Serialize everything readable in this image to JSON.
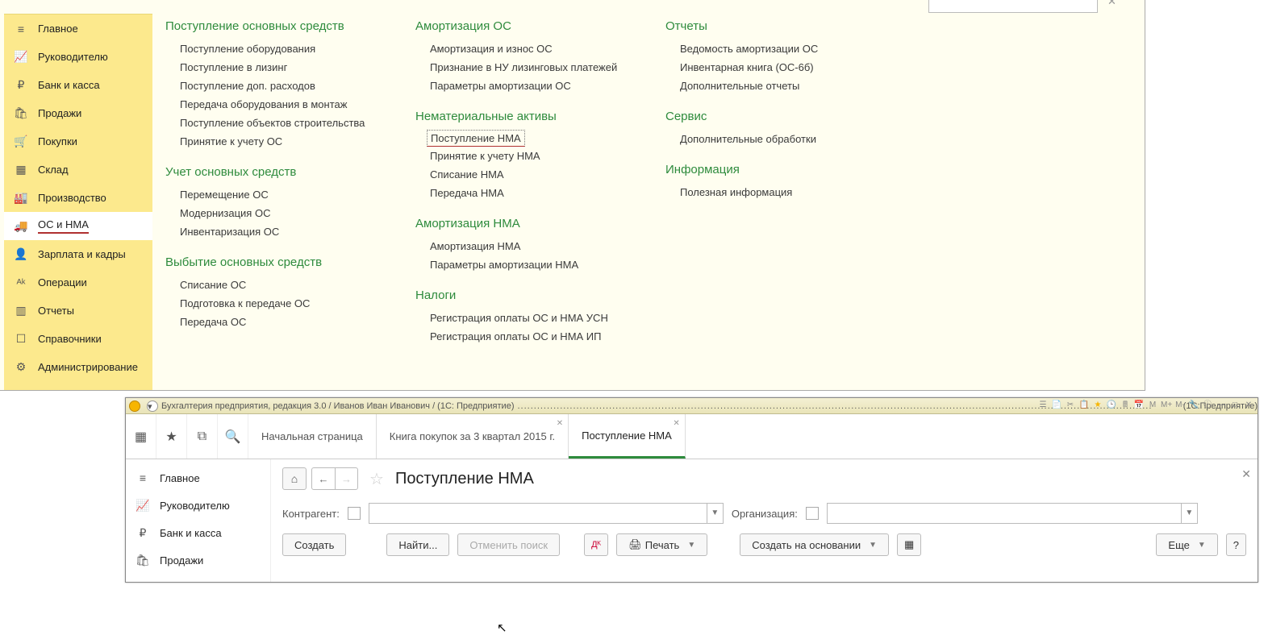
{
  "sidebar": {
    "items": [
      {
        "label": "Главное",
        "icon": "≡"
      },
      {
        "label": "Руководителю",
        "icon": "📈"
      },
      {
        "label": "Банк и касса",
        "icon": "₽"
      },
      {
        "label": "Продажи",
        "icon": "🛍"
      },
      {
        "label": "Покупки",
        "icon": "🛒"
      },
      {
        "label": "Склад",
        "icon": "▦"
      },
      {
        "label": "Производство",
        "icon": "🏭"
      },
      {
        "label": "ОС и НМА",
        "icon": "🚚"
      },
      {
        "label": "Зарплата и кадры",
        "icon": "👤"
      },
      {
        "label": "Операции",
        "icon": "ᴬᵏ"
      },
      {
        "label": "Отчеты",
        "icon": "▥"
      },
      {
        "label": "Справочники",
        "icon": "☐"
      },
      {
        "label": "Администрирование",
        "icon": "⚙"
      }
    ]
  },
  "functions": {
    "col1": [
      {
        "title": "Поступление основных средств",
        "items": [
          "Поступление оборудования",
          "Поступление в лизинг",
          "Поступление доп. расходов",
          "Передача оборудования в монтаж",
          "Поступление объектов строительства",
          "Принятие к учету ОС"
        ]
      },
      {
        "title": "Учет основных средств",
        "items": [
          "Перемещение ОС",
          "Модернизация ОС",
          "Инвентаризация ОС"
        ]
      },
      {
        "title": "Выбытие основных средств",
        "items": [
          "Списание ОС",
          "Подготовка к передаче ОС",
          "Передача ОС"
        ]
      }
    ],
    "col2": [
      {
        "title": "Амортизация ОС",
        "items": [
          "Амортизация и износ ОС",
          "Признание в НУ лизинговых платежей",
          "Параметры амортизации ОС"
        ]
      },
      {
        "title": "Нематериальные активы",
        "items": [
          "Поступление НМА",
          "Принятие к учету НМА",
          "Списание НМА",
          "Передача НМА"
        ]
      },
      {
        "title": "Амортизация НМА",
        "items": [
          "Амортизация НМА",
          "Параметры амортизации НМА"
        ]
      },
      {
        "title": "Налоги",
        "items": [
          "Регистрация оплаты ОС и НМА УСН",
          "Регистрация оплаты ОС и НМА ИП"
        ]
      }
    ],
    "col3": [
      {
        "title": "Отчеты",
        "items": [
          "Ведомость амортизации ОС",
          "Инвентарная книга (ОС-6б)",
          "Дополнительные отчеты"
        ]
      },
      {
        "title": "Сервис",
        "items": [
          "Дополнительные обработки"
        ]
      },
      {
        "title": "Информация",
        "items": [
          "Полезная информация"
        ]
      }
    ]
  },
  "win2": {
    "title_left": "Бухгалтерия предприятия, редакция 3.0 / Иванов Иван Иванович / (1С: Предприятие)",
    "title_right": "(1С:Предприятие)",
    "tabs": [
      "Начальная страница",
      "Книга покупок за 3 квартал 2015 г.",
      "Поступление НМА"
    ],
    "sidebar": [
      {
        "label": "Главное",
        "icon": "≡"
      },
      {
        "label": "Руководителю",
        "icon": "📈"
      },
      {
        "label": "Банк и касса",
        "icon": "₽"
      },
      {
        "label": "Продажи",
        "icon": "🛍"
      }
    ],
    "page_title": "Поступление НМА",
    "filters": {
      "counterparty": "Контрагент:",
      "org": "Организация:"
    },
    "buttons": {
      "create": "Создать",
      "find": "Найти...",
      "cancel_find": "Отменить поиск",
      "print": "Печать",
      "create_based": "Создать на основании",
      "more": "Еще",
      "help": "?"
    }
  }
}
